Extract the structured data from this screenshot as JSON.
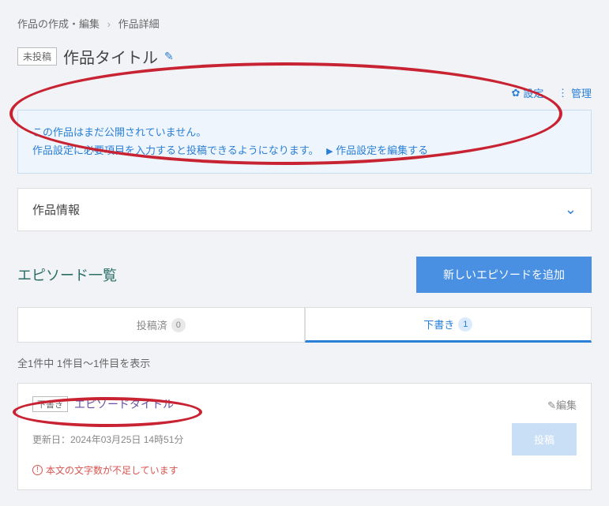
{
  "breadcrumb": {
    "parent": "作品の作成・編集",
    "current": "作品詳細"
  },
  "title": {
    "status_badge": "未投稿",
    "text": "作品タイトル"
  },
  "actions": {
    "settings": "設定",
    "manage": "管理"
  },
  "notice": {
    "line1": "この作品はまだ公開されていません。",
    "line2": "作品設定に必要項目を入力すると投稿できるようになります。",
    "link": "作品設定を編集する"
  },
  "info_panel": {
    "label": "作品情報"
  },
  "episodes": {
    "heading": "エピソード一覧",
    "add_button": "新しいエピソードを追加",
    "tabs": {
      "posted": {
        "label": "投稿済",
        "count": "0"
      },
      "draft": {
        "label": "下書き",
        "count": "1"
      }
    },
    "result_text": "全1件中 1件目～1件目を表示",
    "item": {
      "badge": "下書き",
      "title": "エピソードタイトル",
      "edit": "編集",
      "meta": "更新日：2024年03月25日 14時51分",
      "submit": "投稿",
      "warning": "本文の文字数が不足しています"
    }
  }
}
